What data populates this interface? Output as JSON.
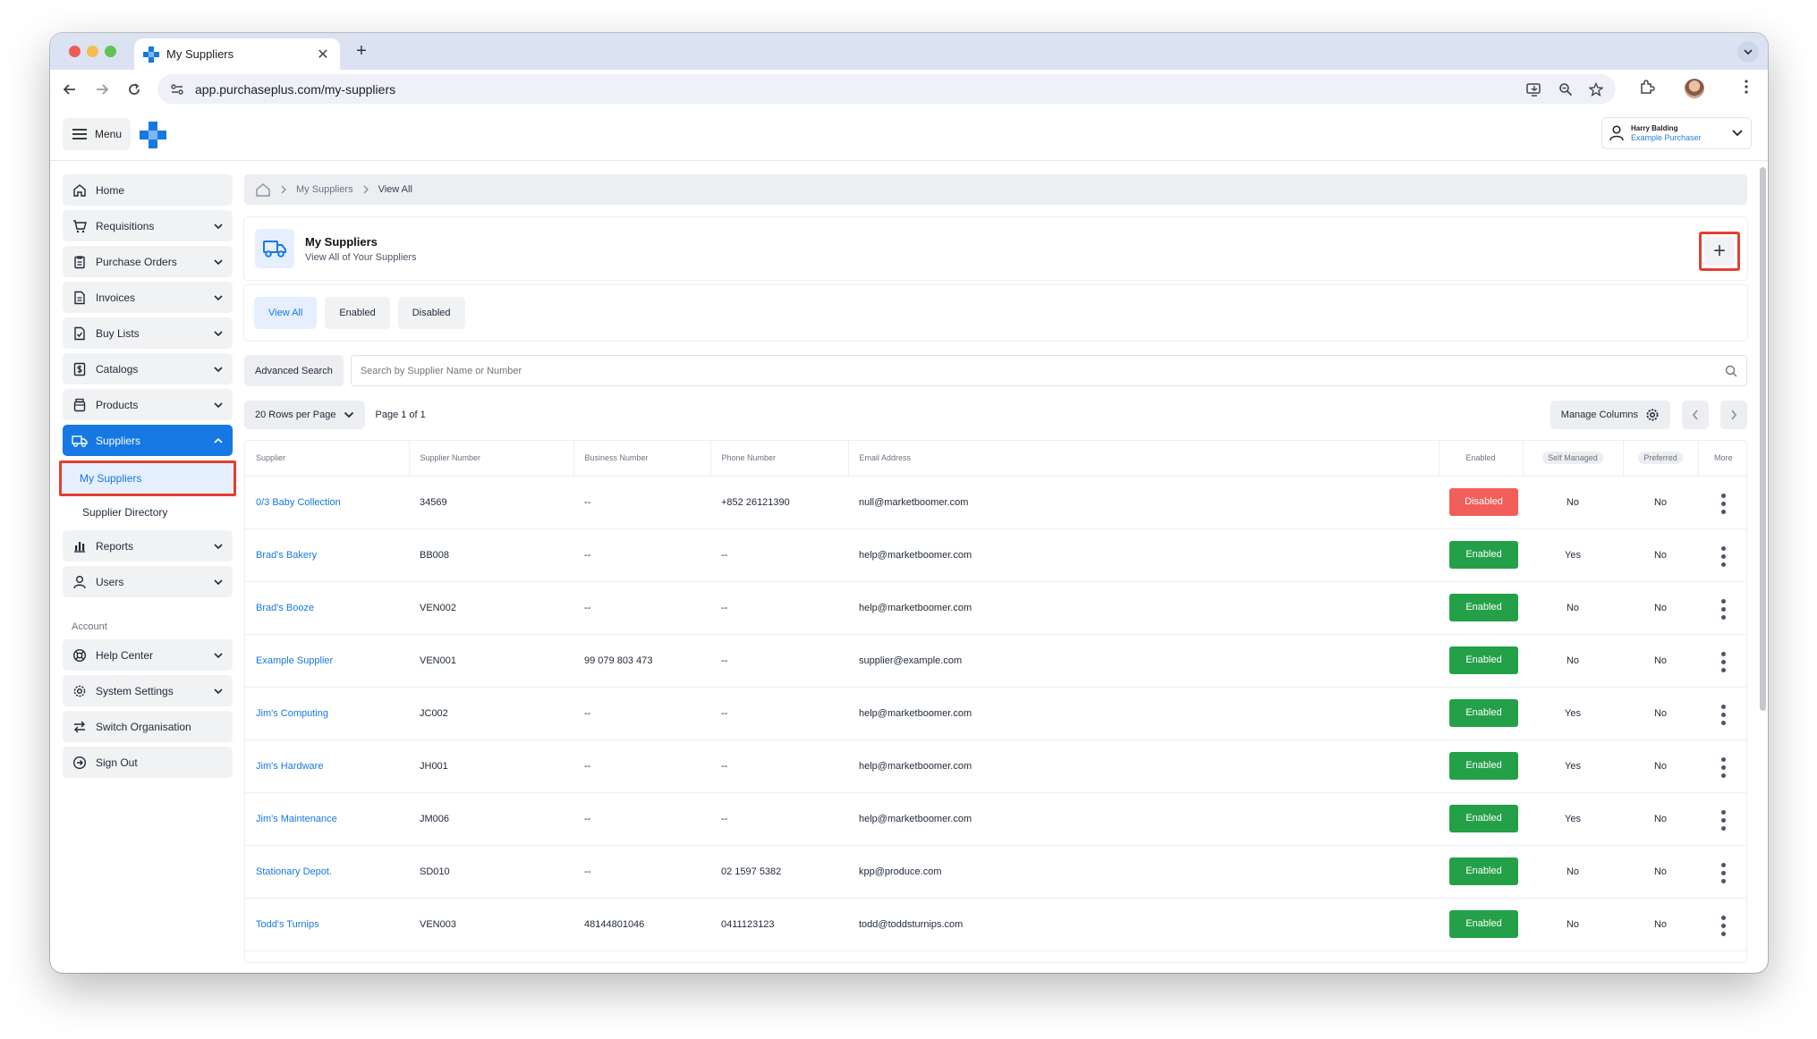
{
  "browser": {
    "tab_title": "My Suppliers",
    "url": "app.purchaseplus.com/my-suppliers"
  },
  "header": {
    "menu_label": "Menu",
    "user_name": "Harry Balding",
    "user_role": "Example Purchaser"
  },
  "sidebar": {
    "items": [
      {
        "label": "Home"
      },
      {
        "label": "Requisitions"
      },
      {
        "label": "Purchase Orders"
      },
      {
        "label": "Invoices"
      },
      {
        "label": "Buy Lists"
      },
      {
        "label": "Catalogs"
      },
      {
        "label": "Products"
      },
      {
        "label": "Suppliers"
      }
    ],
    "sub_items": [
      {
        "label": "My Suppliers"
      },
      {
        "label": "Supplier Directory"
      }
    ],
    "items_after": [
      {
        "label": "Reports"
      },
      {
        "label": "Users"
      }
    ],
    "section_label": "Account",
    "account_items": [
      {
        "label": "Help Center"
      },
      {
        "label": "System Settings"
      },
      {
        "label": "Switch Organisation"
      },
      {
        "label": "Sign Out"
      }
    ]
  },
  "breadcrumb": {
    "level1": "My Suppliers",
    "level2": "View All"
  },
  "page": {
    "title": "My Suppliers",
    "subtitle": "View All of Your Suppliers"
  },
  "filters": [
    "View All",
    "Enabled",
    "Disabled"
  ],
  "search": {
    "advanced_label": "Advanced Search",
    "placeholder": "Search by Supplier Name or Number"
  },
  "pagination": {
    "rows_label": "20 Rows per Page",
    "page_label": "Page 1 of 1",
    "manage_columns_label": "Manage Columns"
  },
  "table": {
    "headers": [
      "Supplier",
      "Supplier Number",
      "Business Number",
      "Phone Number",
      "Email Address",
      "Enabled",
      "Self Managed",
      "Preferred",
      "More"
    ],
    "rows": [
      {
        "supplier": "0/3 Baby Collection",
        "number": "34569",
        "business": "--",
        "phone": "+852 26121390",
        "email": "null@marketboomer.com",
        "status": "Disabled",
        "self_managed": "No",
        "preferred": "No"
      },
      {
        "supplier": "Brad's Bakery",
        "number": "BB008",
        "business": "--",
        "phone": "--",
        "email": "help@marketboomer.com",
        "status": "Enabled",
        "self_managed": "Yes",
        "preferred": "No"
      },
      {
        "supplier": "Brad's Booze",
        "number": "VEN002",
        "business": "--",
        "phone": "--",
        "email": "help@marketboomer.com",
        "status": "Enabled",
        "self_managed": "No",
        "preferred": "No"
      },
      {
        "supplier": "Example Supplier",
        "number": "VEN001",
        "business": "99 079 803 473",
        "phone": "--",
        "email": "supplier@example.com",
        "status": "Enabled",
        "self_managed": "No",
        "preferred": "No"
      },
      {
        "supplier": "Jim's Computing",
        "number": "JC002",
        "business": "--",
        "phone": "--",
        "email": "help@marketboomer.com",
        "status": "Enabled",
        "self_managed": "Yes",
        "preferred": "No"
      },
      {
        "supplier": "Jim's Hardware",
        "number": "JH001",
        "business": "--",
        "phone": "--",
        "email": "help@marketboomer.com",
        "status": "Enabled",
        "self_managed": "Yes",
        "preferred": "No"
      },
      {
        "supplier": "Jim's Maintenance",
        "number": "JM006",
        "business": "--",
        "phone": "--",
        "email": "help@marketboomer.com",
        "status": "Enabled",
        "self_managed": "Yes",
        "preferred": "No"
      },
      {
        "supplier": "Stationary Depot.",
        "number": "SD010",
        "business": "--",
        "phone": "02 1597 5382",
        "email": "kpp@produce.com",
        "status": "Enabled",
        "self_managed": "No",
        "preferred": "No"
      },
      {
        "supplier": "Todd's Turnips",
        "number": "VEN003",
        "business": "48144801046",
        "phone": "0411123123",
        "email": "todd@toddsturnips.com",
        "status": "Enabled",
        "self_managed": "No",
        "preferred": "No"
      }
    ]
  },
  "colors": {
    "accent": "#1678e3",
    "enabled": "#24a148",
    "disabled": "#f25f5a",
    "highlight": "#e43f2f"
  }
}
